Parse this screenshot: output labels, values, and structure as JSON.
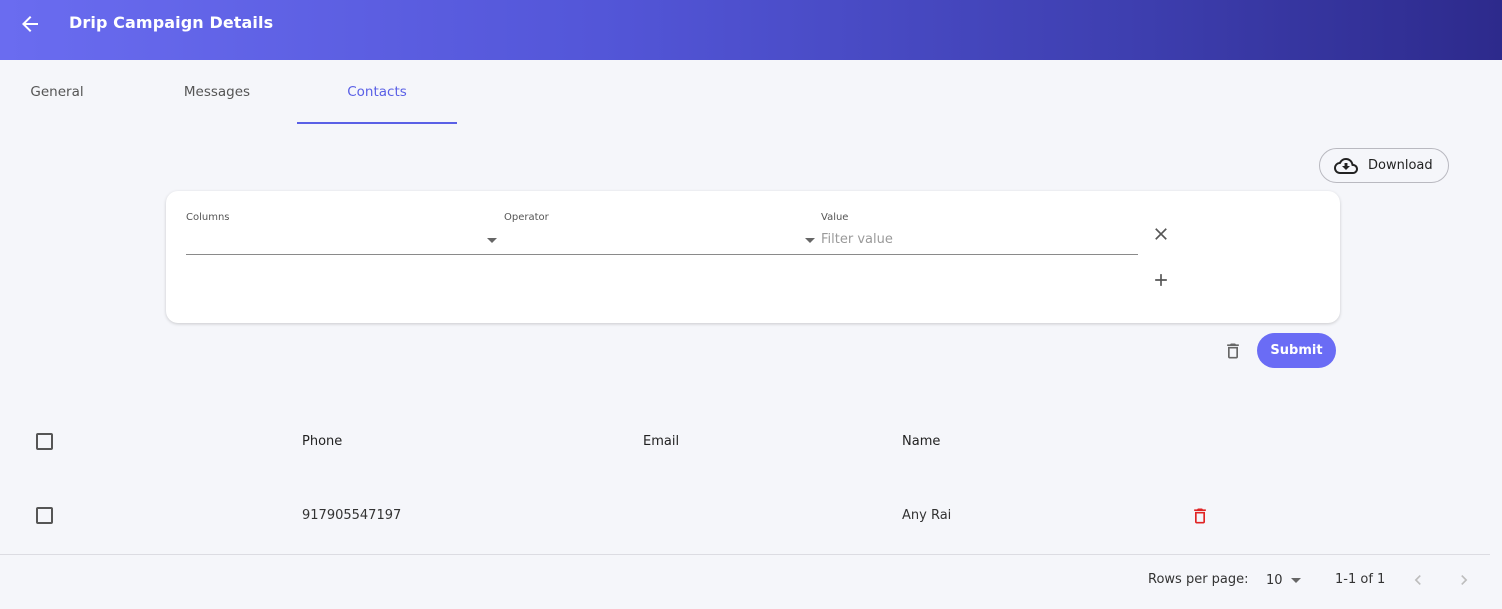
{
  "header": {
    "title": "Drip Campaign Details",
    "gradient_start": "#6a6cf0",
    "gradient_end": "#2d2a8c",
    "back_icon": "arrow-left-icon"
  },
  "tabs": [
    {
      "label": "General",
      "active": false
    },
    {
      "label": "Messages",
      "active": false
    },
    {
      "label": "Contacts",
      "active": true
    }
  ],
  "accent_color": "#5a60e6",
  "download": {
    "label": "Download",
    "icon": "cloud-download-icon"
  },
  "filter": {
    "columns_label": "Columns",
    "columns_value": "",
    "operator_label": "Operator",
    "operator_value": "",
    "value_label": "Value",
    "value_placeholder": "Filter value",
    "remove_icon": "close-icon",
    "add_icon": "plus-icon"
  },
  "actions": {
    "clear_icon": "trash-icon",
    "submit_label": "Submit",
    "submit_color": "#6a6cf5"
  },
  "table": {
    "columns": [
      "Phone",
      "Email",
      "Name"
    ],
    "rows": [
      {
        "phone": "917905547197",
        "email": "",
        "name": "Any Rai",
        "delete_icon": "trash-icon",
        "delete_color": "#e02424"
      }
    ]
  },
  "pagination": {
    "rows_per_page_label": "Rows per page:",
    "rows_per_page_value": "10",
    "range_text": "1-1 of 1",
    "prev_icon": "chevron-left-icon",
    "next_icon": "chevron-right-icon"
  }
}
